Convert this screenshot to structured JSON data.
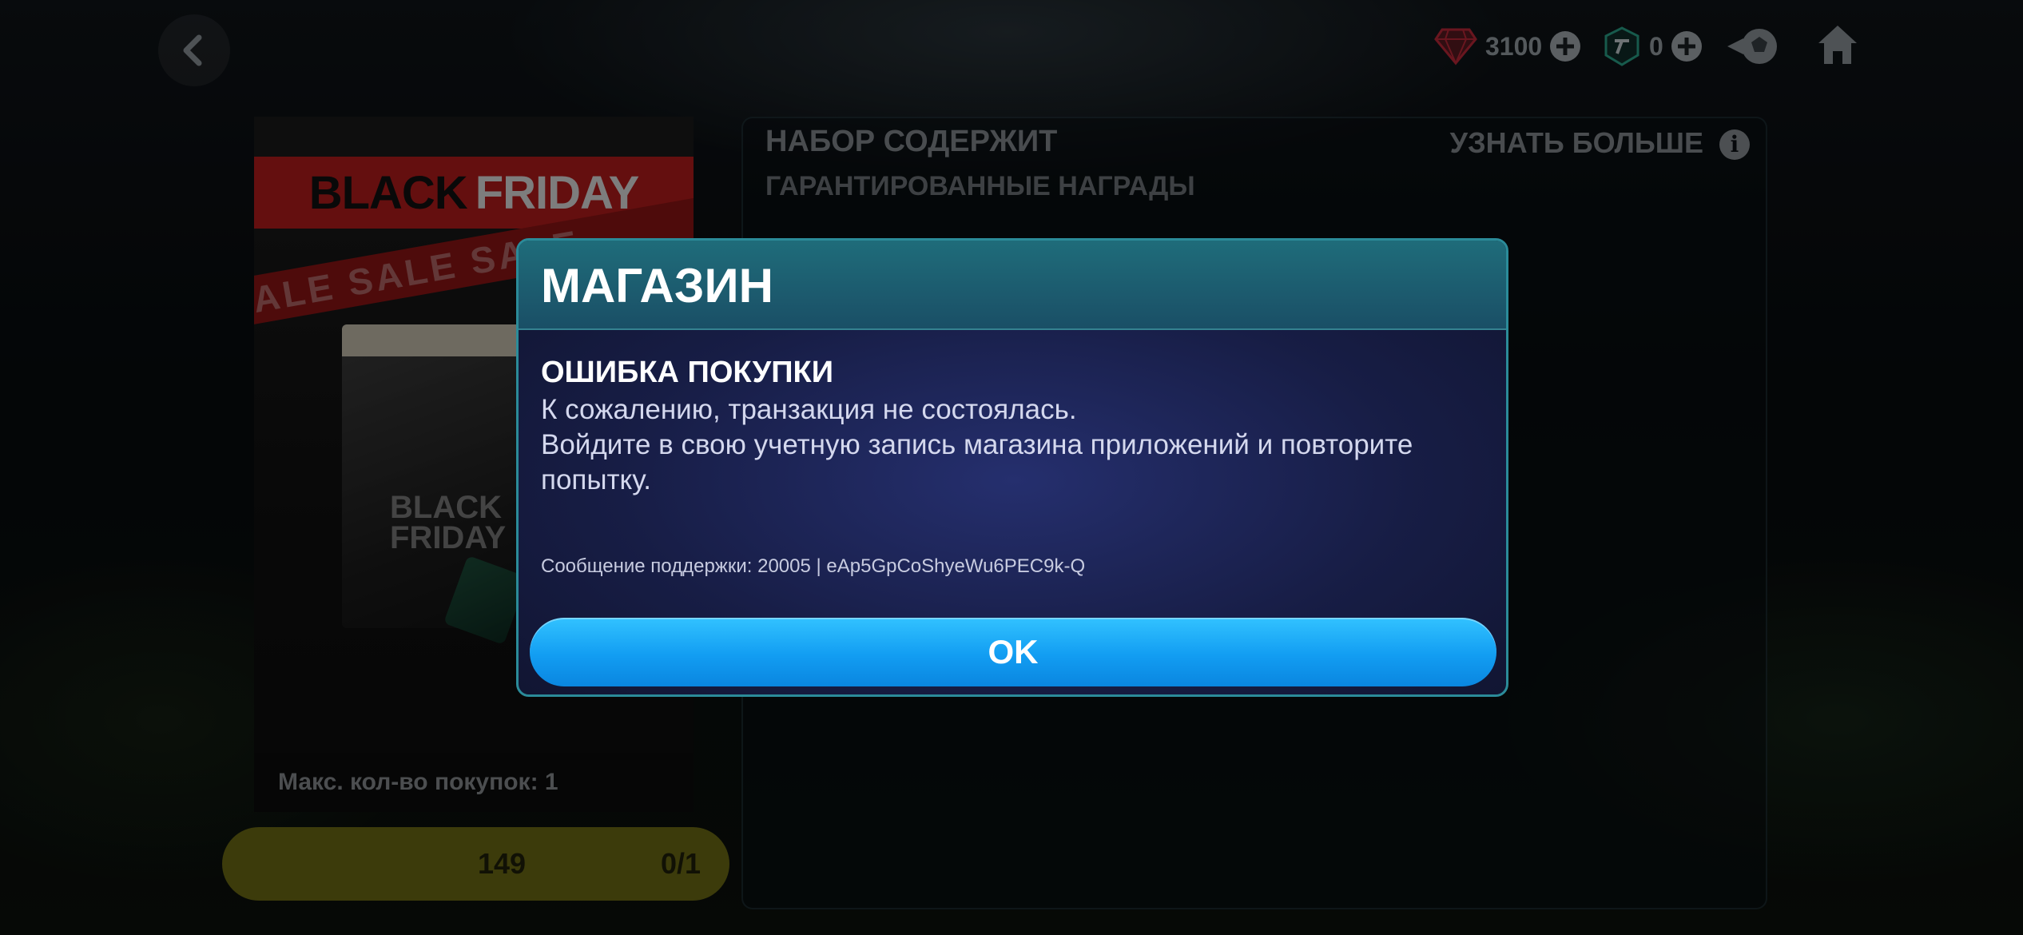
{
  "topbar": {
    "gems_value": "3100",
    "points_value": "0"
  },
  "pack": {
    "banner_black": "BLACK",
    "banner_friday": "FRIDAY",
    "sale_strip": "SALE SALE SALE",
    "box_text": "BLACK FRIDAY",
    "max_purchase": "Макс. кол-во покупок: 1",
    "price": "149",
    "count": "0/1"
  },
  "contents": {
    "title": "НАБОР СОДЕРЖИТ",
    "learn_more": "УЗНАТЬ БОЛЬШЕ",
    "info": "i",
    "guaranteed": "ГАРАНТИРОВАННЫЕ НАГРАДЫ"
  },
  "dialog": {
    "title": "МАГАЗИН",
    "error_title": "ОШИБКА ПОКУПКИ",
    "error_line1": "К сожалению, транзакция не состоялась.",
    "error_line2": "Войдите в свою учетную запись магазина приложений и повторите попытку.",
    "support": "Сообщение поддержки: 20005 | eAp5GpCoShyeWu6PEC9k-Q",
    "ok_label": "OK"
  },
  "colors": {
    "dialog_border": "#2b8b99",
    "ok_button": "#129df2",
    "price_button": "#6d6c14",
    "banner_red": "#b71c1c"
  },
  "icons": [
    "back-arrow-icon",
    "gem-icon",
    "plus-icon",
    "fc-points-icon",
    "ball-icon",
    "home-icon",
    "info-icon"
  ]
}
